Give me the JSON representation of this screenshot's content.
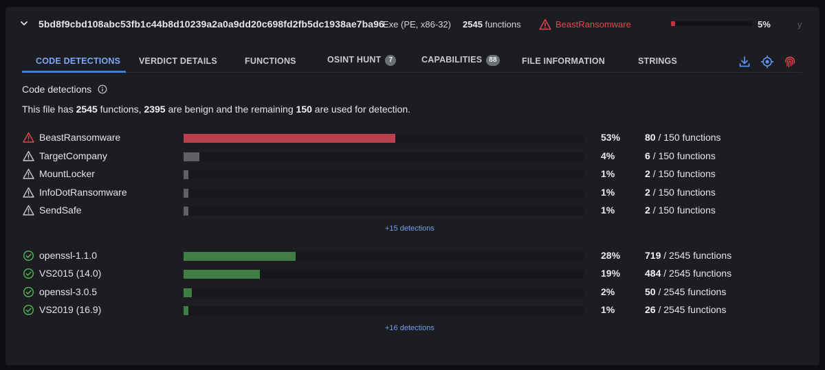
{
  "header": {
    "hash": "5bd8f9cbd108abc53fb1c44b8d10239a2a0a9dd20c698fd2fb5dc1938ae7ba96",
    "file_type": "Exe (PE, x86-32)",
    "function_count": "2545",
    "function_word": "functions",
    "verdict": "BeastRansomware",
    "verdict_percent_value": 5,
    "verdict_percent": "5%",
    "overflow_text": "y",
    "colors": {
      "verdict": "#e2474f",
      "verdict_bar": "#c8323f"
    }
  },
  "tabs": [
    {
      "label": "CODE DETECTIONS",
      "active": true
    },
    {
      "label": "VERDICT DETAILS"
    },
    {
      "label": "FUNCTIONS"
    },
    {
      "label": "OSINT HUNT",
      "badge": "7"
    },
    {
      "label": "CAPABILITIES",
      "badge": "88"
    },
    {
      "label": "FILE INFORMATION"
    },
    {
      "label": "STRINGS"
    }
  ],
  "toolbar_icons": [
    "download-icon",
    "target-icon",
    "fingerprint-icon"
  ],
  "section": {
    "title": "Code detections",
    "summary": {
      "prefix": "This file has ",
      "total": "2545",
      "mid1": " functions, ",
      "benign": "2395",
      "mid2": " are benign and the remaining ",
      "detected": "150",
      "suffix": " are used for detection."
    }
  },
  "malicious": [
    {
      "name": "BeastRansomware",
      "percent": "53%",
      "value": 53,
      "count": "80",
      "total": "/ 150 functions",
      "severity": "high"
    },
    {
      "name": "TargetCompany",
      "percent": "4%",
      "value": 4,
      "count": "6",
      "total": "/ 150 functions",
      "severity": "low"
    },
    {
      "name": "MountLocker",
      "percent": "1%",
      "value": 1,
      "count": "2",
      "total": "/ 150 functions",
      "severity": "low"
    },
    {
      "name": "InfoDotRansomware",
      "percent": "1%",
      "value": 1,
      "count": "2",
      "total": "/ 150 functions",
      "severity": "low"
    },
    {
      "name": "SendSafe",
      "percent": "1%",
      "value": 1,
      "count": "2",
      "total": "/ 150 functions",
      "severity": "low"
    }
  ],
  "malicious_more": "+15 detections",
  "benign": [
    {
      "name": "openssl-1.1.0",
      "percent": "28%",
      "value": 28,
      "count": "719",
      "total": "/ 2545 functions"
    },
    {
      "name": "VS2015 (14.0)",
      "percent": "19%",
      "value": 19,
      "count": "484",
      "total": "/ 2545 functions"
    },
    {
      "name": "openssl-3.0.5",
      "percent": "2%",
      "value": 2,
      "count": "50",
      "total": "/ 2545 functions"
    },
    {
      "name": "VS2019 (16.9)",
      "percent": "1%",
      "value": 1,
      "count": "26",
      "total": "/ 2545 functions"
    }
  ],
  "benign_more": "+16 detections",
  "colors": {
    "high_bar": "#b9404f",
    "low_bar": "#5f6166",
    "benign_bar": "#3f7f45",
    "benign_icon": "#4caf50",
    "high_icon": "#e2474f",
    "low_icon": "#c9cace",
    "accent": "#3f7de8"
  }
}
